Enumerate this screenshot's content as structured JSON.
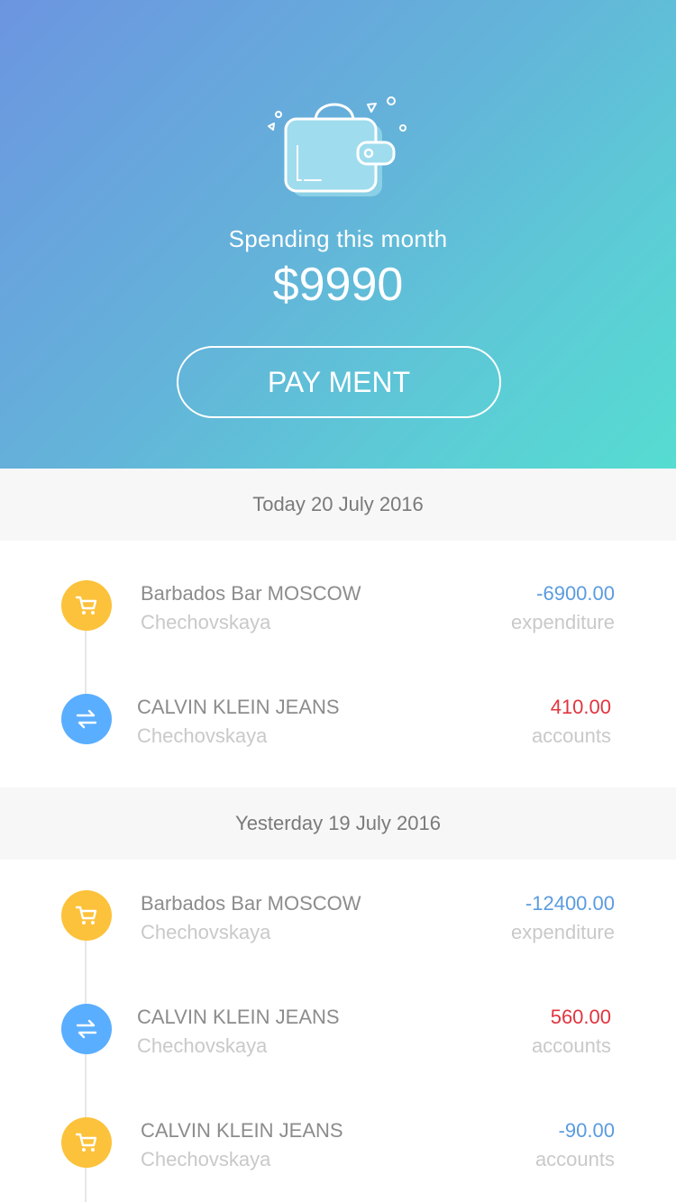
{
  "header": {
    "label": "Spending this month",
    "amount": "$9990",
    "payment_button": "PAY MENT"
  },
  "colors": {
    "gradient_start": "#6c95e0",
    "gradient_end": "#56dcd1",
    "shop_icon_bg": "#fcc23b",
    "transfer_icon_bg": "#5aaeff",
    "negative_amount": "#5a9be0",
    "positive_amount": "#e0353f"
  },
  "sections": [
    {
      "date": "Today 20 July 2016",
      "transactions": [
        {
          "icon": "cart-icon",
          "name": "Barbados Bar MOSCOW",
          "sub": "Chechovskaya",
          "amount": "-6900.00",
          "type": "expenditure"
        },
        {
          "icon": "transfer-icon",
          "name": "CALVIN KLEIN JEANS",
          "sub": "Chechovskaya",
          "amount": "410.00",
          "type": "accounts"
        }
      ]
    },
    {
      "date": "Yesterday 19 July 2016",
      "transactions": [
        {
          "icon": "cart-icon",
          "name": "Barbados Bar MOSCOW",
          "sub": "Chechovskaya",
          "amount": "-12400.00",
          "type": "expenditure"
        },
        {
          "icon": "transfer-icon",
          "name": "CALVIN KLEIN JEANS",
          "sub": "Chechovskaya",
          "amount": "560.00",
          "type": "accounts"
        },
        {
          "icon": "cart-icon",
          "name": "CALVIN KLEIN JEANS",
          "sub": "Chechovskaya",
          "amount": "-90.00",
          "type": "accounts"
        }
      ]
    }
  ]
}
